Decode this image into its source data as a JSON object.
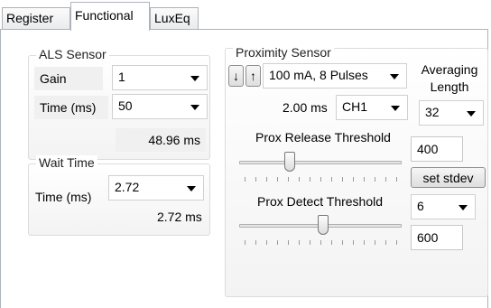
{
  "tabs": [
    {
      "label": "Register"
    },
    {
      "label": "Functional"
    },
    {
      "label": "LuxEq"
    }
  ],
  "als_sensor": {
    "title": "ALS Sensor",
    "gain_label": "Gain",
    "gain_value": "1",
    "time_label": "Time (ms)",
    "time_value": "50",
    "time_readout": "48.96 ms"
  },
  "wait_time": {
    "title": "Wait Time",
    "time_label": "Time (ms)",
    "time_value": "2.72",
    "time_readout": "2.72 ms"
  },
  "proximity": {
    "title": "Proximity Sensor",
    "down_arrow": "↓",
    "up_arrow": "↑",
    "led_value": "100 mA, 8 Pulses",
    "averaging_label": "Averaging Length",
    "averaging_value": "32",
    "time_readout": "2.00 ms",
    "channel_value": "CH1",
    "release_label": "Prox Release Threshold",
    "release_value": "400",
    "release_slider_level": 0.3,
    "set_stdev_label": "set stdev",
    "stdev_value": "6",
    "detect_label": "Prox Detect Threshold",
    "detect_value": "600",
    "detect_slider_level": 0.52
  }
}
